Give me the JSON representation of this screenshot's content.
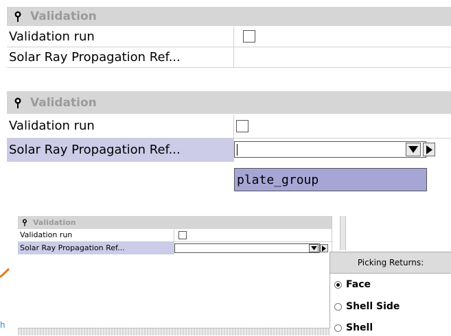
{
  "panels": [
    {
      "section_title": "Validation",
      "rows": [
        {
          "label": "Validation run",
          "type": "checkbox",
          "checked": false
        },
        {
          "label": "Solar Ray Propagation Ref...",
          "type": "empty"
        }
      ]
    },
    {
      "section_title": "Validation",
      "rows": [
        {
          "label": "Validation run",
          "type": "checkbox",
          "checked": false
        },
        {
          "label": "Solar Ray Propagation Ref...",
          "type": "combo",
          "value": ""
        }
      ],
      "dropdown_option": "plate_group"
    },
    {
      "section_title": "Validation",
      "rows": [
        {
          "label": "Validation run",
          "type": "checkbox",
          "checked": false
        },
        {
          "label": "Solar Ray Propagation Ref...",
          "type": "combo",
          "value": ""
        }
      ]
    }
  ],
  "picking_popup": {
    "title": "Picking Returns:",
    "options": [
      {
        "label": "Face",
        "selected": true
      },
      {
        "label": "Shell Side",
        "selected": false
      },
      {
        "label": "Shell",
        "selected": false
      }
    ]
  },
  "left_fragment_text": "h",
  "colors": {
    "header_bg": "#d6d6d6",
    "header_text": "#9a9a9a",
    "row_highlight": "#cccce8",
    "dropdown_bg": "#a6a6d6"
  }
}
